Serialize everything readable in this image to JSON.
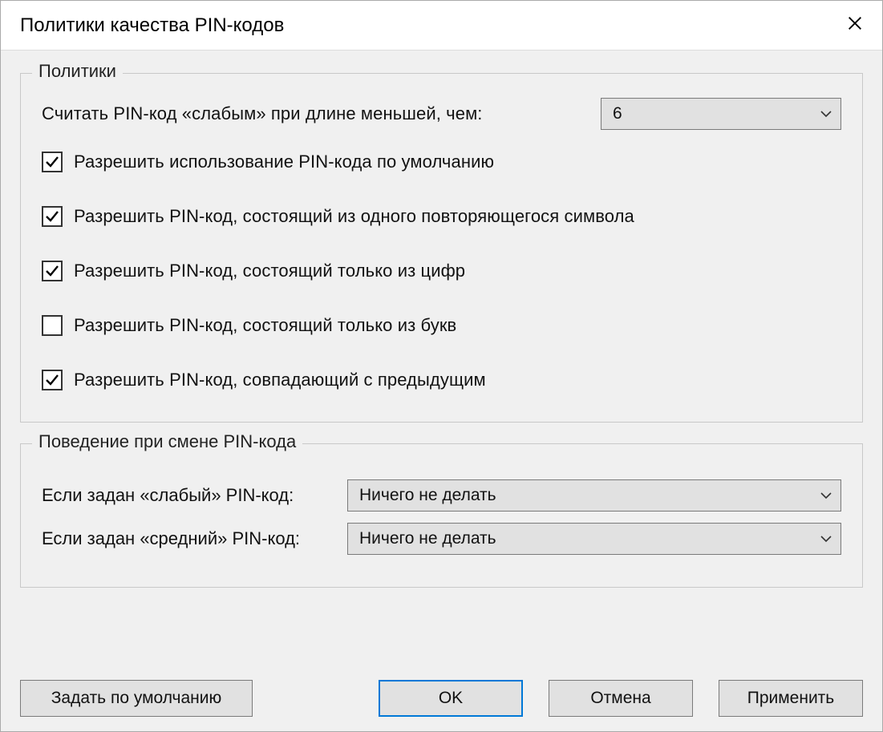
{
  "dialog": {
    "title": "Политики качества PIN-кодов"
  },
  "policies": {
    "legend": "Политики",
    "weak_length_label": "Считать PIN-код «слабым» при длине меньшей, чем:",
    "weak_length_value": "6",
    "cb_allow_default": {
      "label": "Разрешить использование PIN-кода по умолчанию",
      "checked": true
    },
    "cb_allow_repeating": {
      "label": "Разрешить PIN-код, состоящий из одного повторяющегося символа",
      "checked": true
    },
    "cb_allow_digits_only": {
      "label": "Разрешить PIN-код, состоящий только из цифр",
      "checked": true
    },
    "cb_allow_letters_only": {
      "label": "Разрешить PIN-код, состоящий только из букв",
      "checked": false
    },
    "cb_allow_same_as_prev": {
      "label": "Разрешить PIN-код, совпадающий с предыдущим",
      "checked": true
    }
  },
  "behavior": {
    "legend": "Поведение при смене PIN-кода",
    "weak_label": "Если задан «слабый» PIN-код:",
    "weak_value": "Ничего не делать",
    "medium_label": "Если задан «средний» PIN-код:",
    "medium_value": "Ничего не делать"
  },
  "buttons": {
    "set_default": "Задать по умолчанию",
    "ok": "OK",
    "cancel": "Отмена",
    "apply": "Применить"
  }
}
